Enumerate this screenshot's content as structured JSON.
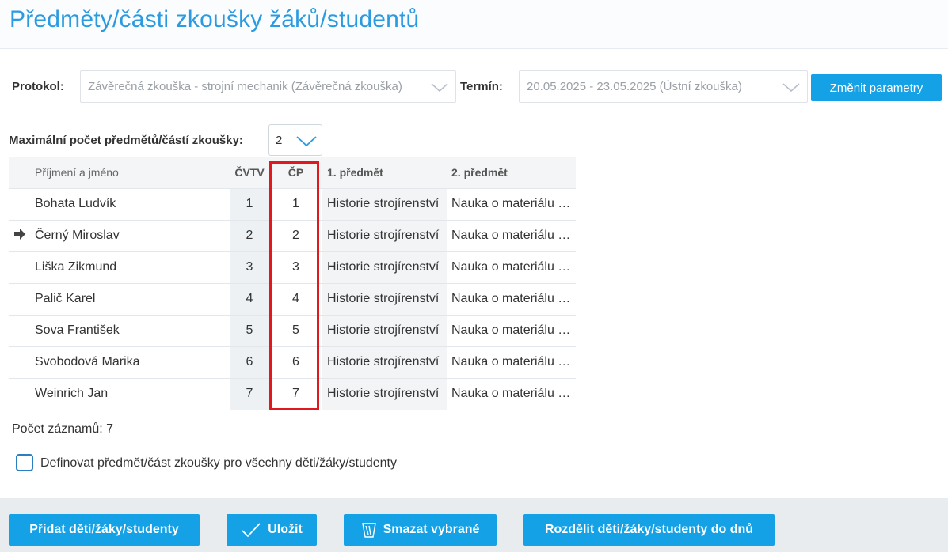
{
  "page": {
    "title": "Předměty/části zkoušky žáků/studentů"
  },
  "filters": {
    "protocol_label": "Protokol:",
    "protocol_value": "Závěrečná zkouška - strojní mechanik (Závěrečná zkouška)",
    "term_label": "Termín:",
    "term_value": "20.05.2025 - 23.05.2025 (Ústní zkouška)",
    "change_button": "Změnit parametry"
  },
  "max_subjects": {
    "label": "Maximální počet předmětů/částí zkoušky:",
    "value": "2"
  },
  "table": {
    "headers": {
      "name": "Příjmení a jméno",
      "cvtv": "ČVTV",
      "cp": "ČP",
      "subject1": "1. předmět",
      "subject2": "2. předmět"
    },
    "rows": [
      {
        "name": "Bohata Ludvík",
        "cvtv": "1",
        "cp": "1",
        "subject1": "Historie strojírenství",
        "subject2": "Nauka o materiálu a technologie",
        "current": false
      },
      {
        "name": "Černý Miroslav",
        "cvtv": "2",
        "cp": "2",
        "subject1": "Historie strojírenství",
        "subject2": "Nauka o materiálu a technologie",
        "current": true
      },
      {
        "name": "Liška Zikmund",
        "cvtv": "3",
        "cp": "3",
        "subject1": "Historie strojírenství",
        "subject2": "Nauka o materiálu a technologie",
        "current": false
      },
      {
        "name": "Palič Karel",
        "cvtv": "4",
        "cp": "4",
        "subject1": "Historie strojírenství",
        "subject2": "Nauka o materiálu a technologie",
        "current": false
      },
      {
        "name": "Sova František",
        "cvtv": "5",
        "cp": "5",
        "subject1": "Historie strojírenství",
        "subject2": "Nauka o materiálu a technologie",
        "current": false
      },
      {
        "name": "Svobodová Marika",
        "cvtv": "6",
        "cp": "6",
        "subject1": "Historie strojírenství",
        "subject2": "Nauka o materiálu a technologie",
        "current": false
      },
      {
        "name": "Weinrich Jan",
        "cvtv": "7",
        "cp": "7",
        "subject1": "Historie strojírenství",
        "subject2": "Nauka o materiálu a technologie",
        "current": false
      }
    ]
  },
  "record_count": "Počet záznamů: 7",
  "define_all": {
    "label": "Definovat předmět/část zkoušky pro všechny děti/žáky/studenty",
    "checked": false
  },
  "footer": {
    "add_button": "Přidat děti/žáky/studenty",
    "save_button": "Uložit",
    "delete_button": "Smazat vybrané",
    "split_button": "Rozdělit děti/žáky/studenty do dnů"
  },
  "colors": {
    "accent": "#14a1e6",
    "title": "#2a9be0",
    "highlight": "#e0191f"
  }
}
